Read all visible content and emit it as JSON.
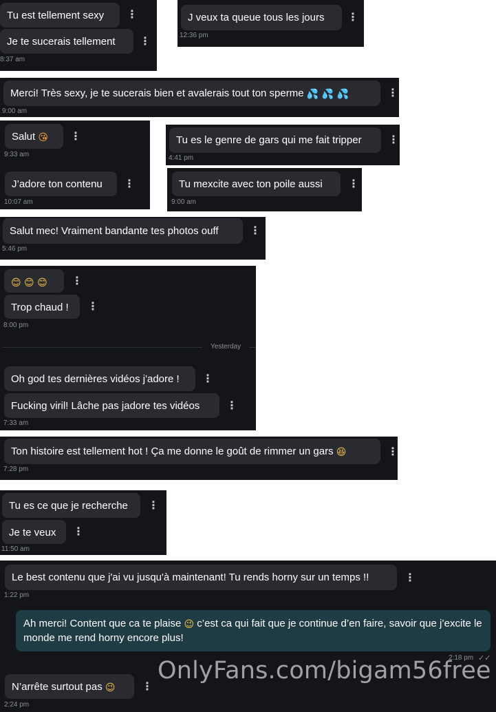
{
  "messages": {
    "m1": {
      "text": "Tu est tellement sexy"
    },
    "m2": {
      "text": "Je te sucerais tellement",
      "time": "8:37 am"
    },
    "m3": {
      "text": "J veux ta queue tous les jours",
      "time": "12:36 pm"
    },
    "m4": {
      "text": "Merci! Très sexy, je te sucerais bien et avalerais tout ton sperme",
      "emoji": "💦 💦 💦",
      "time": "9:00 am"
    },
    "m5": {
      "text": "Salut",
      "emoji": "😘",
      "time": "9:33 am"
    },
    "m6": {
      "text": "J’adore ton contenu",
      "time": "10:07 am"
    },
    "m7": {
      "text": "Tu es le genre de gars qui me fait tripper",
      "time": "4:41 pm"
    },
    "m8": {
      "text": "Tu mexcite avec ton poile aussi",
      "time": "9:00 am"
    },
    "m9": {
      "text": "Salut mec! Vraiment bandante tes photos ouff",
      "time": "5:46 pm"
    },
    "m10": {
      "emoji": "😊 😊 😊"
    },
    "m11": {
      "text": "Trop chaud !",
      "time": "8:00 pm"
    },
    "separator": {
      "label": "Yesterday"
    },
    "m12": {
      "text": "Oh god tes dernières vidéos j'adore !"
    },
    "m13": {
      "text": "Fucking viril! Lâche pas jadore tes vidéos",
      "time": "7:33 am"
    },
    "m14": {
      "text": "Ton histoire est tellement hot ! Ça me donne le goût de rimmer un gars",
      "emoji": "😆",
      "time": "7:28 pm"
    },
    "m15": {
      "text": "Tu es ce que je recherche"
    },
    "m16": {
      "text": "Je te veux",
      "time": "11:50 am"
    },
    "m17": {
      "text": "Le best contenu que j'ai vu jusqu'à maintenant! Tu rends horny sur un temps !!",
      "time": "1:22 pm"
    },
    "m18": {
      "text_a": "Ah merci! Content que ca te plaise",
      "emoji": "😉",
      "text_b": "c’est ca qui fait que je continue d’en faire, savoir que j’excite le monde me rend horny encore plus!",
      "time": "2:18 pm"
    },
    "m19": {
      "text": "N’arrête surtout pas",
      "emoji": "😉",
      "time": "2:24 pm"
    }
  },
  "icons": {
    "more": "⋮",
    "double_check": "✓✓"
  },
  "watermark": {
    "text": "OnlyFans.com/bigam56free"
  },
  "colors": {
    "panel_bg": "#141519",
    "incoming_bubble": "#2a2b30",
    "outgoing_bubble": "#1f3b44",
    "timestamp": "#8c8f96"
  }
}
